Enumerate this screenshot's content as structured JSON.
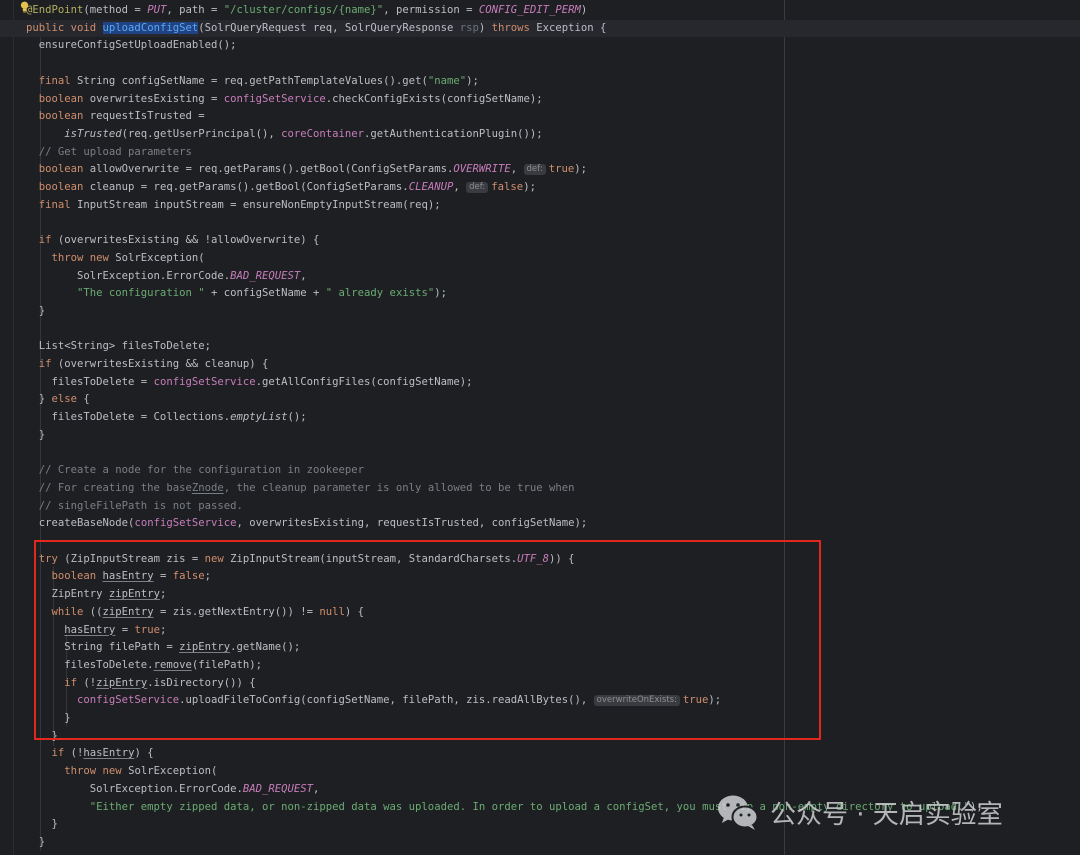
{
  "editor": {
    "lines": [
      {
        "segs": [
          [
            "ann",
            "@EndPoint"
          ],
          [
            "",
            "(method = "
          ],
          [
            "cst",
            "PUT"
          ],
          [
            "",
            ", path = "
          ],
          [
            "str",
            "\"/cluster/configs/{name}\""
          ],
          [
            "",
            ", permission = "
          ],
          [
            "cst",
            "CONFIG_EDIT_PERM"
          ],
          [
            "",
            ")"
          ]
        ]
      },
      {
        "segs": [
          [
            "kw",
            "public void "
          ],
          [
            "fn",
            "uploadConfigSet"
          ],
          [
            "",
            "(SolrQueryRequest req, SolrQueryResponse "
          ],
          [
            "grey",
            "rsp"
          ],
          [
            "",
            ") "
          ],
          [
            "kw",
            "throws "
          ],
          [
            "",
            "Exception {"
          ]
        ]
      },
      {
        "segs": [
          [
            "",
            "  ensureConfigSetUploadEnabled();"
          ]
        ]
      },
      {
        "segs": []
      },
      {
        "segs": [
          [
            "kw",
            "  final "
          ],
          [
            "",
            "String configSetName = req.getPathTemplateValues().get("
          ],
          [
            "str",
            "\"name\""
          ],
          [
            "",
            ");"
          ]
        ]
      },
      {
        "segs": [
          [
            "kw",
            "  boolean "
          ],
          [
            "",
            "overwritesExisting = "
          ],
          [
            "fld",
            "configSetService"
          ],
          [
            "",
            ".checkConfigExists(configSetName);"
          ]
        ]
      },
      {
        "segs": [
          [
            "kw",
            "  boolean "
          ],
          [
            "",
            "requestIsTrusted ="
          ]
        ]
      },
      {
        "segs": [
          [
            "ital",
            "      isTrusted"
          ],
          [
            "",
            "(req.getUserPrincipal(), "
          ],
          [
            "fld",
            "coreContainer"
          ],
          [
            "",
            ".getAuthenticationPlugin());"
          ]
        ]
      },
      {
        "segs": [
          [
            "cmt",
            "  // Get upload parameters"
          ]
        ]
      },
      {
        "segs": [
          [
            "kw",
            "  boolean "
          ],
          [
            "",
            "allowOverwrite = req.getParams().getBool(ConfigSetParams."
          ],
          [
            "cst",
            "OVERWRITE"
          ],
          [
            "",
            ", "
          ],
          [
            "hint",
            "def:"
          ],
          [
            "kw",
            "true"
          ],
          [
            "",
            ");"
          ]
        ]
      },
      {
        "segs": [
          [
            "kw",
            "  boolean "
          ],
          [
            "",
            "cleanup = req.getParams().getBool(ConfigSetParams."
          ],
          [
            "cst",
            "CLEANUP"
          ],
          [
            "",
            ", "
          ],
          [
            "hint",
            "def:"
          ],
          [
            "kw",
            "false"
          ],
          [
            "",
            ");"
          ]
        ]
      },
      {
        "segs": [
          [
            "kw",
            "  final "
          ],
          [
            "",
            "InputStream inputStream = ensureNonEmptyInputStream(req);"
          ]
        ]
      },
      {
        "segs": []
      },
      {
        "segs": [
          [
            "kw",
            "  if "
          ],
          [
            "",
            "(overwritesExisting && !allowOverwrite) {"
          ]
        ]
      },
      {
        "segs": [
          [
            "kw",
            "    throw new "
          ],
          [
            "",
            "SolrException("
          ]
        ]
      },
      {
        "segs": [
          [
            "",
            "        SolrException.ErrorCode."
          ],
          [
            "cst",
            "BAD_REQUEST"
          ],
          [
            "",
            ","
          ]
        ]
      },
      {
        "segs": [
          [
            "str",
            "        \"The configuration \" "
          ],
          [
            "",
            "+ configSetName + "
          ],
          [
            "str",
            "\" already exists\""
          ],
          [
            "",
            ");"
          ]
        ]
      },
      {
        "segs": [
          [
            "",
            "  }"
          ]
        ]
      },
      {
        "segs": []
      },
      {
        "segs": [
          [
            "",
            "  List<String> filesToDelete;"
          ]
        ]
      },
      {
        "segs": [
          [
            "kw",
            "  if "
          ],
          [
            "",
            "(overwritesExisting && cleanup) {"
          ]
        ]
      },
      {
        "segs": [
          [
            "",
            "    filesToDelete = "
          ],
          [
            "fld",
            "configSetService"
          ],
          [
            "",
            ".getAllConfigFiles(configSetName);"
          ]
        ]
      },
      {
        "segs": [
          [
            "",
            "  } "
          ],
          [
            "kw",
            "else "
          ],
          [
            "",
            "{"
          ]
        ]
      },
      {
        "segs": [
          [
            "",
            "    filesToDelete = Collections."
          ],
          [
            "ital",
            "emptyList"
          ],
          [
            "",
            "();"
          ]
        ]
      },
      {
        "segs": [
          [
            "",
            "  }"
          ]
        ]
      },
      {
        "segs": []
      },
      {
        "segs": [
          [
            "cmt",
            "  // Create a node for the configuration in zookeeper"
          ]
        ]
      },
      {
        "segs": [
          [
            "cmt",
            "  // For creating the base"
          ],
          [
            "cmt uw",
            "Znode"
          ],
          [
            "cmt",
            ", the cleanup parameter is only allowed to be true when"
          ]
        ]
      },
      {
        "segs": [
          [
            "cmt",
            "  // singleFilePath is not passed."
          ]
        ]
      },
      {
        "segs": [
          [
            "",
            "  createBaseNode("
          ],
          [
            "fld",
            "configSetService"
          ],
          [
            "",
            ", overwritesExisting, requestIsTrusted, configSetName);"
          ]
        ]
      },
      {
        "segs": []
      },
      {
        "segs": [
          [
            "kw",
            "  try "
          ],
          [
            "",
            "(ZipInputStream zis = "
          ],
          [
            "kw",
            "new "
          ],
          [
            "",
            "ZipInputStream(inputStream, StandardCharsets."
          ],
          [
            "cst",
            "UTF_8"
          ],
          [
            "",
            ")) {"
          ]
        ]
      },
      {
        "segs": [
          [
            "kw",
            "    boolean "
          ],
          [
            "uw",
            "hasEntry"
          ],
          [
            "kw",
            ""
          ],
          [
            "",
            " = "
          ],
          [
            "kw",
            "false"
          ],
          [
            "",
            ";"
          ]
        ]
      },
      {
        "segs": [
          [
            "",
            "    ZipEntry "
          ],
          [
            "uw",
            "zipEntry"
          ],
          [
            "",
            ";"
          ]
        ]
      },
      {
        "segs": [
          [
            "kw",
            "    while "
          ],
          [
            "",
            "(("
          ],
          [
            "uw",
            "zipEntry"
          ],
          [
            "",
            " = zis.getNextEntry()) != "
          ],
          [
            "kw",
            "null"
          ],
          [
            "",
            ") {"
          ]
        ]
      },
      {
        "segs": [
          [
            "",
            "      "
          ],
          [
            "uw",
            "hasEntry"
          ],
          [
            "",
            " = "
          ],
          [
            "kw",
            "true"
          ],
          [
            "",
            ";"
          ]
        ]
      },
      {
        "segs": [
          [
            "",
            "      String filePath = "
          ],
          [
            "uw",
            "zipEntry"
          ],
          [
            "",
            ".getName();"
          ]
        ]
      },
      {
        "segs": [
          [
            "",
            "      filesToDelete."
          ],
          [
            "uw",
            "remove"
          ],
          [
            "",
            "(filePath);"
          ]
        ]
      },
      {
        "segs": [
          [
            "kw",
            "      if "
          ],
          [
            "",
            "(!"
          ],
          [
            "uw",
            "zipEntry"
          ],
          [
            "",
            ".isDirectory()) {"
          ]
        ]
      },
      {
        "segs": [
          [
            "fld",
            "        configSetService"
          ],
          [
            "",
            ".uploadFileToConfig(configSetName, filePath, zis.readAllBytes(), "
          ],
          [
            "hint",
            "overwriteOnExists:"
          ],
          [
            "kw",
            "true"
          ],
          [
            "",
            ");"
          ]
        ]
      },
      {
        "segs": [
          [
            "",
            "      }"
          ]
        ]
      },
      {
        "segs": [
          [
            "",
            "    }"
          ]
        ]
      },
      {
        "segs": [
          [
            "kw",
            "    if "
          ],
          [
            "",
            "(!"
          ],
          [
            "uw",
            "hasEntry"
          ],
          [
            "",
            ") {"
          ]
        ]
      },
      {
        "segs": [
          [
            "kw",
            "      throw new "
          ],
          [
            "",
            "SolrException("
          ]
        ]
      },
      {
        "segs": [
          [
            "",
            "          SolrException.ErrorCode."
          ],
          [
            "cst",
            "BAD_REQUEST"
          ],
          [
            "",
            ","
          ]
        ]
      },
      {
        "segs": [
          [
            "str",
            "          \"Either empty zipped data, or non-zipped data was uploaded. In order to upload a configSet, you must zip a non-empty directory to upload.\""
          ],
          [
            "",
            ");"
          ]
        ]
      },
      {
        "segs": [
          [
            "",
            "    }"
          ]
        ]
      },
      {
        "segs": [
          [
            "",
            "  }"
          ]
        ]
      }
    ]
  },
  "watermark": {
    "text": "公众号 · 天启实验室",
    "logo_icon": "wechat-icon"
  },
  "colors": {
    "background": "#1e1f22",
    "keyword": "#cf8e6d",
    "string": "#6aab73",
    "field": "#c77dbb",
    "highlight_box": "#e0281f"
  }
}
